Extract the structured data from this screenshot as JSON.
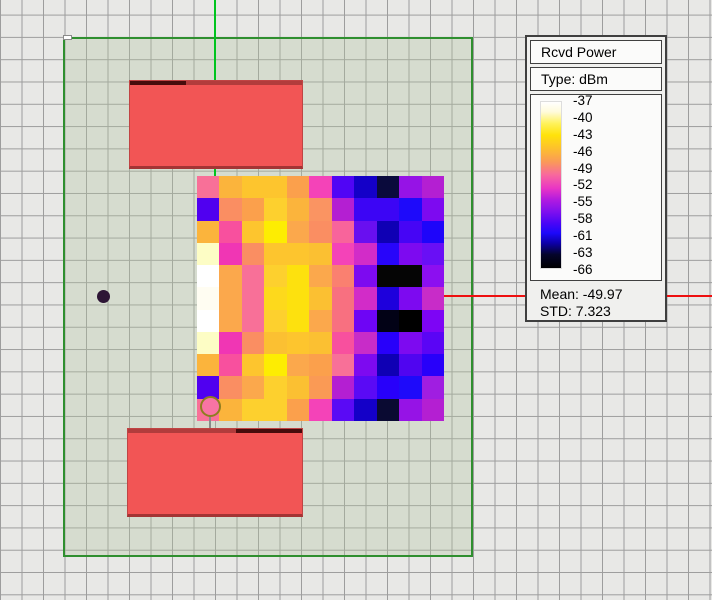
{
  "legend": {
    "title": "Rcvd Power",
    "type_label": "Type: dBm",
    "unit": "dBm",
    "ticks": [
      "-37",
      "-40",
      "-43",
      "-46",
      "-49",
      "-52",
      "-55",
      "-58",
      "-61",
      "-63",
      "-66"
    ],
    "mean_label": "Mean: -49.97",
    "std_label": "STD: 7.323",
    "mean_value": -49.97,
    "std_value": 7.323,
    "colorbar_stops": [
      {
        "pos": 0,
        "color": "#ffffff"
      },
      {
        "pos": 6,
        "color": "#fffbda"
      },
      {
        "pos": 13,
        "color": "#fff25a"
      },
      {
        "pos": 20,
        "color": "#ffe20a"
      },
      {
        "pos": 28,
        "color": "#fdc02e"
      },
      {
        "pos": 36,
        "color": "#fa9a58"
      },
      {
        "pos": 44,
        "color": "#f8689e"
      },
      {
        "pos": 52,
        "color": "#e935c5"
      },
      {
        "pos": 59,
        "color": "#b01be0"
      },
      {
        "pos": 66,
        "color": "#8010ee"
      },
      {
        "pos": 73,
        "color": "#4a06f6"
      },
      {
        "pos": 79,
        "color": "#1c08fa"
      },
      {
        "pos": 85,
        "color": "#0d00a8"
      },
      {
        "pos": 92,
        "color": "#04042a"
      },
      {
        "pos": 100,
        "color": "#000000"
      }
    ]
  },
  "chart_data": {
    "type": "heatmap",
    "title": "Rcvd Power",
    "unit": "dBm",
    "scale_min": -66,
    "scale_max": -37,
    "scale_ticks": [
      -37,
      -40,
      -43,
      -46,
      -49,
      -52,
      -55,
      -58,
      -61,
      -63,
      -66
    ],
    "mean": -49.97,
    "std": 7.323,
    "rows": 11,
    "cols": 11,
    "cell_colors": [
      [
        "#f87098",
        "#fbb43c",
        "#fdc52e",
        "#fdc52e",
        "#fba04c",
        "#f443b8",
        "#5005f5",
        "#1400c8",
        "#0a0a3c",
        "#9613e6",
        "#b41fd2"
      ],
      [
        "#5000f0",
        "#fa8e62",
        "#fba04c",
        "#fdd02e",
        "#fbb43c",
        "#fa9462",
        "#b41fd2",
        "#3c05f5",
        "#3c05f5",
        "#1e0afa",
        "#7d0af0"
      ],
      [
        "#fbb43c",
        "#f8509e",
        "#fdc52e",
        "#fded02",
        "#fba84c",
        "#fa8e62",
        "#f8649b",
        "#690ff0",
        "#0f00b4",
        "#4605f5",
        "#1e05fa"
      ],
      [
        "#fdfdc5",
        "#f036b4",
        "#fa8e62",
        "#fdc52e",
        "#fdc52e",
        "#fbc032",
        "#f443b8",
        "#d22cc8",
        "#2805fa",
        "#7d0af0",
        "#690ff5"
      ],
      [
        "#ffffff",
        "#fba84c",
        "#f87098",
        "#fdd02e",
        "#fde10e",
        "#fba84c",
        "#fa8070",
        "#7d0af0",
        "#050505",
        "#050505",
        "#8c0ff0"
      ],
      [
        "#fffdf2",
        "#fba84c",
        "#f87098",
        "#fdd91c",
        "#fde10e",
        "#fbc032",
        "#f87080",
        "#d22cc8",
        "#1e00dc",
        "#7d0af0",
        "#c82cc8"
      ],
      [
        "#ffffff",
        "#fba84c",
        "#f87098",
        "#fdd02e",
        "#fde10e",
        "#fba84c",
        "#f87080",
        "#6e05f5",
        "#020216",
        "#000000",
        "#7d05f5"
      ],
      [
        "#fdfdc5",
        "#f036b4",
        "#fa8e62",
        "#fbc032",
        "#fdc52e",
        "#fbc032",
        "#f8509e",
        "#c82cc8",
        "#2800fa",
        "#7d0af0",
        "#5a05f5"
      ],
      [
        "#fbb43c",
        "#f8509e",
        "#fdc52e",
        "#fded02",
        "#fba84c",
        "#fba04c",
        "#f87098",
        "#7d0af0",
        "#0f00b4",
        "#5005f0",
        "#2800fa"
      ],
      [
        "#5000f0",
        "#fa8e62",
        "#fba84c",
        "#fdd02e",
        "#fbc032",
        "#fa9a55",
        "#b41fd2",
        "#5a0af5",
        "#2800fa",
        "#1e0afa",
        "#a01ee1"
      ],
      [
        "#f87098",
        "#fbb43c",
        "#fdd02e",
        "#fdd02e",
        "#fba04c",
        "#f443b8",
        "#5a0af5",
        "#1400c8",
        "#0a0a32",
        "#9613e6",
        "#b41fd2"
      ]
    ]
  },
  "scene": {
    "study_area_border_color": "#2f8f2f",
    "building_fill_color": "#f25555",
    "building_roof_color": "#b23c3c",
    "building_roof_dark_color": "#470c0c",
    "tx_axis_color": "#00c41e",
    "x_axis_color": "#ee0f0f",
    "receiver_point_color": "#2d1535",
    "transmitter_point_color": "#f874a4",
    "transmitter_ring_color": "#8f7d20",
    "grid_line_color": "#9d9d9d",
    "background_color": "#e8e8e6"
  }
}
